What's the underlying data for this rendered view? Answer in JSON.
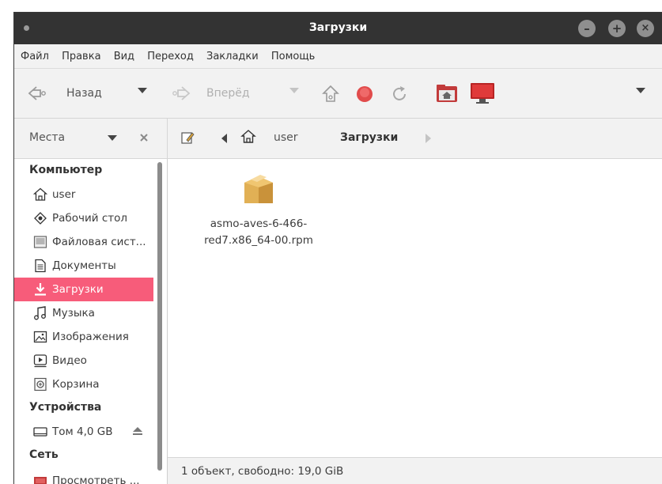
{
  "window": {
    "title": "Загрузки"
  },
  "menubar": {
    "items": [
      "Файл",
      "Правка",
      "Вид",
      "Переход",
      "Закладки",
      "Помощь"
    ]
  },
  "toolbar": {
    "back_label": "Назад",
    "forward_label": "Вперёд"
  },
  "location": {
    "places_label": "Места",
    "breadcrumb": [
      "user",
      "Загрузки"
    ]
  },
  "sidebar": {
    "sections": {
      "computer": "Компьютер",
      "devices": "Устройства",
      "network": "Сеть"
    },
    "computer_items": [
      {
        "label": "user",
        "icon": "home-icon"
      },
      {
        "label": "Рабочий стол",
        "icon": "desktop-icon"
      },
      {
        "label": "Файловая сист...",
        "icon": "drive-icon"
      },
      {
        "label": "Документы",
        "icon": "document-icon"
      },
      {
        "label": "Загрузки",
        "icon": "download-icon",
        "active": true
      },
      {
        "label": "Музыка",
        "icon": "music-icon"
      },
      {
        "label": "Изображения",
        "icon": "image-icon"
      },
      {
        "label": "Видео",
        "icon": "video-icon"
      },
      {
        "label": "Корзина",
        "icon": "trash-icon"
      }
    ],
    "device_items": [
      {
        "label": "Том 4,0 GB",
        "icon": "volume-icon"
      }
    ],
    "network_items": [
      {
        "label": "Просмотреть ...",
        "icon": "network-icon"
      }
    ]
  },
  "files": [
    {
      "name": "asmo-aves-6-466-red7.x86_64-00.rpm",
      "name_line1": "asmo-aves-6-466-",
      "name_line2": "red7.x86_64-00.rpm",
      "icon": "package-icon"
    }
  ],
  "status": {
    "text": "1 объект, свободно: 19,0 GiB"
  },
  "colors": {
    "accent": "#f75c7a",
    "titlebar": "#333333"
  }
}
